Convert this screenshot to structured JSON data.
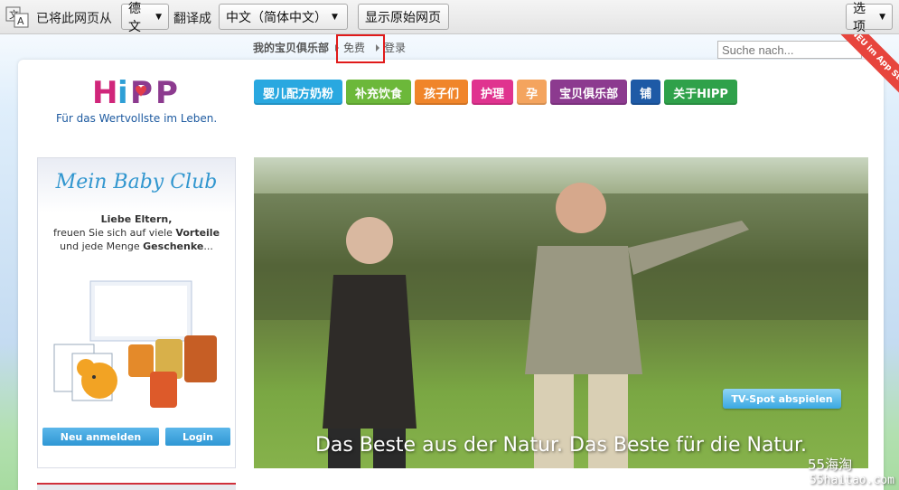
{
  "translate_bar": {
    "message": "已将此网页从",
    "source_language": "德文",
    "translated_to_label": "翻译成",
    "target_language": "中文（简体中文）",
    "show_original_label": "显示原始网页",
    "options_label": "选项"
  },
  "top_nav": {
    "club": "我的宝贝俱乐部",
    "free": "免费",
    "login": "登录"
  },
  "search": {
    "placeholder": "Suche nach..."
  },
  "corner_ribbon": {
    "text": "NEU im App Store"
  },
  "brand": {
    "logo_text": "HiPP",
    "tagline": "Für das Wertvollste im Leben."
  },
  "main_menu": [
    {
      "label": "婴儿配方奶粉",
      "color": "#29a8e0"
    },
    {
      "label": "补充饮食",
      "color": "#6cb83a"
    },
    {
      "label": "孩子们",
      "color": "#f0852a"
    },
    {
      "label": "护理",
      "color": "#e0338f"
    },
    {
      "label": "孕",
      "color": "#f4a45e"
    },
    {
      "label": "宝贝俱乐部",
      "color": "#8c3a8f"
    },
    {
      "label": "铺",
      "color": "#1e5aa6"
    },
    {
      "label": "关于HIPP",
      "color": "#2fa14a"
    }
  ],
  "club_box": {
    "title": "Mein Baby Club",
    "greeting": "Liebe Eltern,",
    "line2_pre": "freuen Sie sich auf viele ",
    "line2_bold": "Vorteile",
    "line3_pre": "und jede Menge ",
    "line3_bold": "Geschenke",
    "line3_post": "...",
    "register_button": "Neu anmelden",
    "login_button": "Login"
  },
  "hero": {
    "caption": "Das Beste aus der Natur. Das Beste für die Natur.",
    "tv_button": "TV-Spot abspielen"
  },
  "watermark": {
    "line1": "55海淘",
    "line2": "55haitao.com"
  }
}
